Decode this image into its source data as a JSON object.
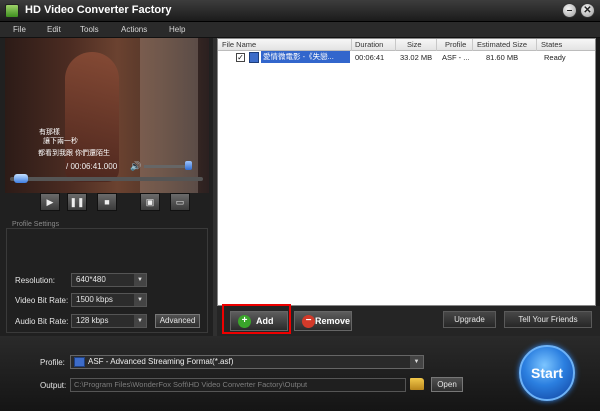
{
  "window": {
    "title": "HD Video Converter Factory",
    "min": "–",
    "close": "✕"
  },
  "menu": [
    "File",
    "Edit",
    "Tools",
    "Actions",
    "Help"
  ],
  "player": {
    "subtitle_lines": [
      "有那樣",
      "讓下兩一秒",
      "都看到我跟 你們還陌生"
    ],
    "time": "/ 00:06:41.000",
    "vol_icon": "🔊",
    "seek_fraction": 0.04,
    "controls": {
      "play": "▶",
      "pause": "❚❚",
      "stop": "■",
      "snapshot": "▣",
      "folder": "▭"
    }
  },
  "settings": {
    "legend": "Profile Settings",
    "resolution": {
      "label": "Resolution:",
      "value": "640*480"
    },
    "video_bitrate": {
      "label": "Video Bit Rate:",
      "value": "1500 kbps"
    },
    "audio_bitrate": {
      "label": "Audio Bit Rate:",
      "value": "128 kbps"
    },
    "advanced": "Advanced"
  },
  "file_list": {
    "columns": [
      "File Name",
      "Duration",
      "Size",
      "Profile",
      "Estimated Size",
      "States"
    ],
    "rows": [
      {
        "checked": "✓",
        "name": "愛情微電影 -《失戀...",
        "duration": "00:06:41",
        "size": "33.02 MB",
        "profile": "ASF - ...",
        "estimated_size": "81.60 MB",
        "state": "Ready"
      }
    ]
  },
  "actions": {
    "add": "Add",
    "add_icon": "+",
    "remove": "Remove",
    "remove_icon": "−",
    "upgrade": "Upgrade",
    "tell": "Tell Your Friends"
  },
  "bottom": {
    "profile_label": "Profile:",
    "profile_value": "ASF - Advanced Streaming Format(*.asf)",
    "output_label": "Output:",
    "output_value": "C:\\Program Files\\WonderFox Soft\\HD Video Converter Factory\\Output",
    "open": "Open",
    "start": "Start"
  },
  "colors": {
    "accent": "#2b7fe0",
    "highlight": "#ee0000"
  }
}
